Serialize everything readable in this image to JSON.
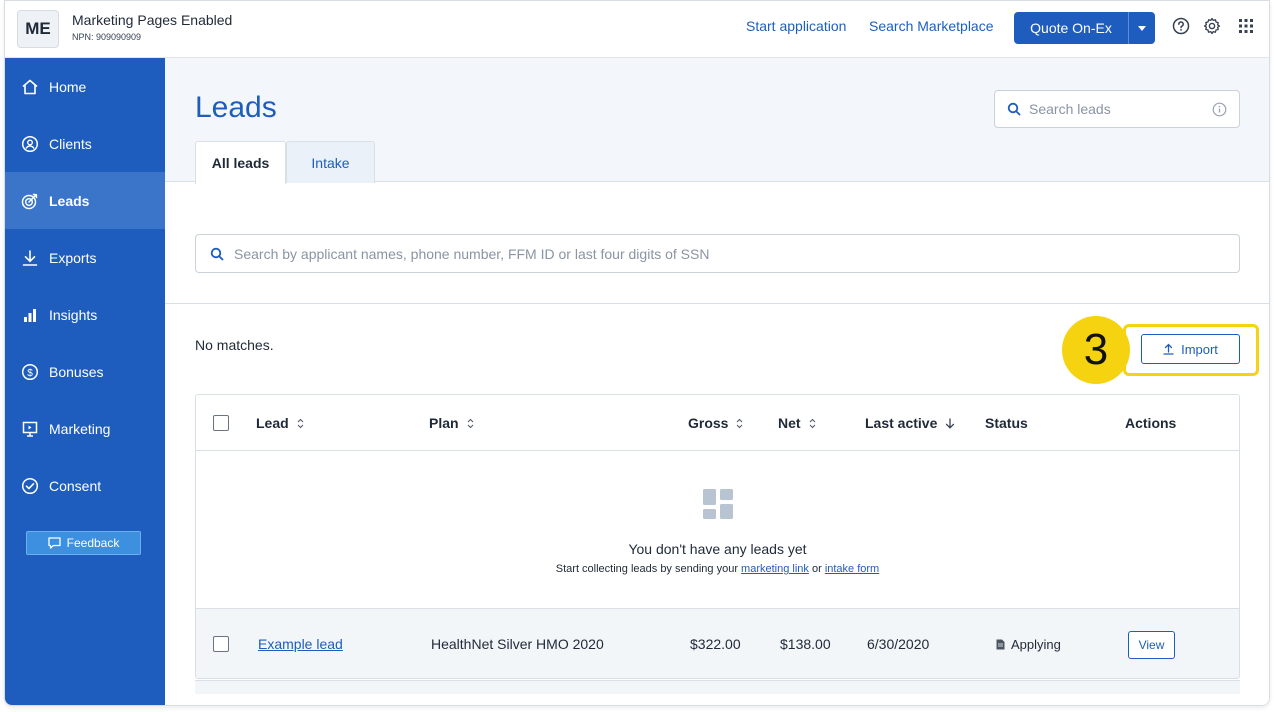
{
  "account": {
    "initials": "ME",
    "name": "Marketing Pages Enabled",
    "npn": "NPN: 909090909"
  },
  "topbar": {
    "start_application": "Start application",
    "search_marketplace": "Search Marketplace",
    "quote_label": "Quote On-Ex",
    "icons": [
      "help-icon",
      "settings-gear-icon",
      "apps-grid-icon"
    ]
  },
  "sidebar": {
    "items": [
      {
        "label": "Home",
        "icon": "home-icon",
        "active": false
      },
      {
        "label": "Clients",
        "icon": "clients-icon",
        "active": false
      },
      {
        "label": "Leads",
        "icon": "target-icon",
        "active": true
      },
      {
        "label": "Exports",
        "icon": "download-icon",
        "active": false
      },
      {
        "label": "Insights",
        "icon": "bar-chart-icon",
        "active": false
      },
      {
        "label": "Bonuses",
        "icon": "dollar-circle-icon",
        "active": false
      },
      {
        "label": "Marketing",
        "icon": "presentation-icon",
        "active": false
      },
      {
        "label": "Consent",
        "icon": "check-circle-icon",
        "active": false
      }
    ],
    "feedback_label": "Feedback"
  },
  "page": {
    "title": "Leads",
    "search_placeholder": "Search leads",
    "tabs": [
      {
        "label": "All leads",
        "active": true
      },
      {
        "label": "Intake",
        "active": false
      }
    ],
    "filter_placeholder": "Search by applicant names, phone number, FFM ID or last four digits of SSN",
    "no_matches": "No matches.",
    "import_label": "Import",
    "step_number": "3"
  },
  "table": {
    "columns": [
      "Lead",
      "Plan",
      "Gross",
      "Net",
      "Last active",
      "Status",
      "Actions"
    ],
    "empty_title": "You don't have any leads yet",
    "empty_sub_prefix": "Start collecting leads by sending your",
    "empty_link_marketing": "marketing link",
    "empty_sub_or": "or",
    "empty_link_intake": "intake form",
    "rows": [
      {
        "lead": "Example lead",
        "plan": "HealthNet Silver HMO 2020",
        "gross": "$322.00",
        "net": "$138.00",
        "last_active": "6/30/2020",
        "status": "Applying",
        "action": "View"
      }
    ]
  },
  "colors": {
    "brand_blue": "#1e5dbd",
    "sidebar_active": "#3a75c9",
    "highlight_yellow": "#f5d311"
  }
}
